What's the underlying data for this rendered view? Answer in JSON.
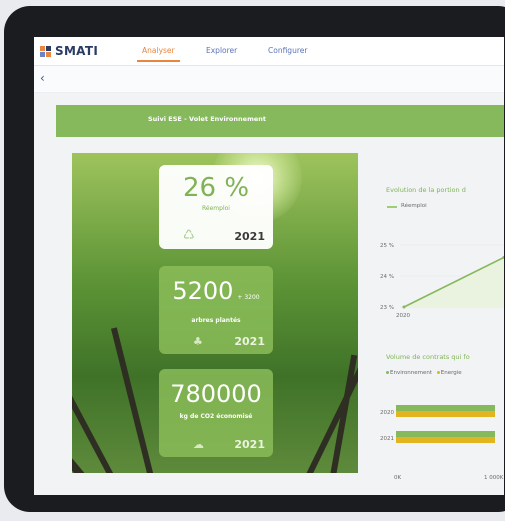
{
  "app": {
    "logo_text": "SMATI",
    "logo_colors": [
      "#e8853e",
      "#2a3b66",
      "#6c84c7",
      "#e8853e"
    ]
  },
  "nav": {
    "items": [
      {
        "label": "Analyser",
        "active": true
      },
      {
        "label": "Explorer",
        "active": false
      },
      {
        "label": "Configurer",
        "active": false
      }
    ]
  },
  "back_icon": "chevron-left-icon",
  "banner": {
    "title": "Suivi ESE - Volet Environnement"
  },
  "kpis": [
    {
      "value": "26 %",
      "label": "Réemploi",
      "year": "2021",
      "icon": "recycle-icon"
    },
    {
      "value": "5200",
      "unit": "+ 3200",
      "label": "arbres plantés",
      "year": "2021",
      "icon": "tree-icon"
    },
    {
      "value": "780000",
      "label": "kg de CO2 économisé",
      "year": "2021",
      "icon": "cloud-icon"
    }
  ],
  "chart_data": [
    {
      "type": "line",
      "title": "Evolution de la portion d",
      "series": [
        {
          "name": "Réemploi",
          "x": [
            "2020",
            "2021"
          ],
          "values": [
            23,
            24.6
          ]
        }
      ],
      "y_ticks": [
        "25 %",
        "24 %",
        "23 %"
      ],
      "x_ticks": [
        "2020"
      ],
      "ylim": [
        23,
        25
      ],
      "color": "#86b95c"
    },
    {
      "type": "bar",
      "orientation": "horizontal",
      "stacked": false,
      "title": "Volume de contrats qui fo",
      "categories": [
        "2020",
        "2021"
      ],
      "series": [
        {
          "name": "Environnement",
          "color": "#86b95c",
          "values": [
            1100,
            1100
          ]
        },
        {
          "name": "Energie",
          "color": "#e2b41f",
          "values": [
            1100,
            1100
          ]
        }
      ],
      "x_ticks": [
        "0K",
        "1 000K"
      ],
      "xlim": [
        0,
        1000
      ]
    }
  ]
}
